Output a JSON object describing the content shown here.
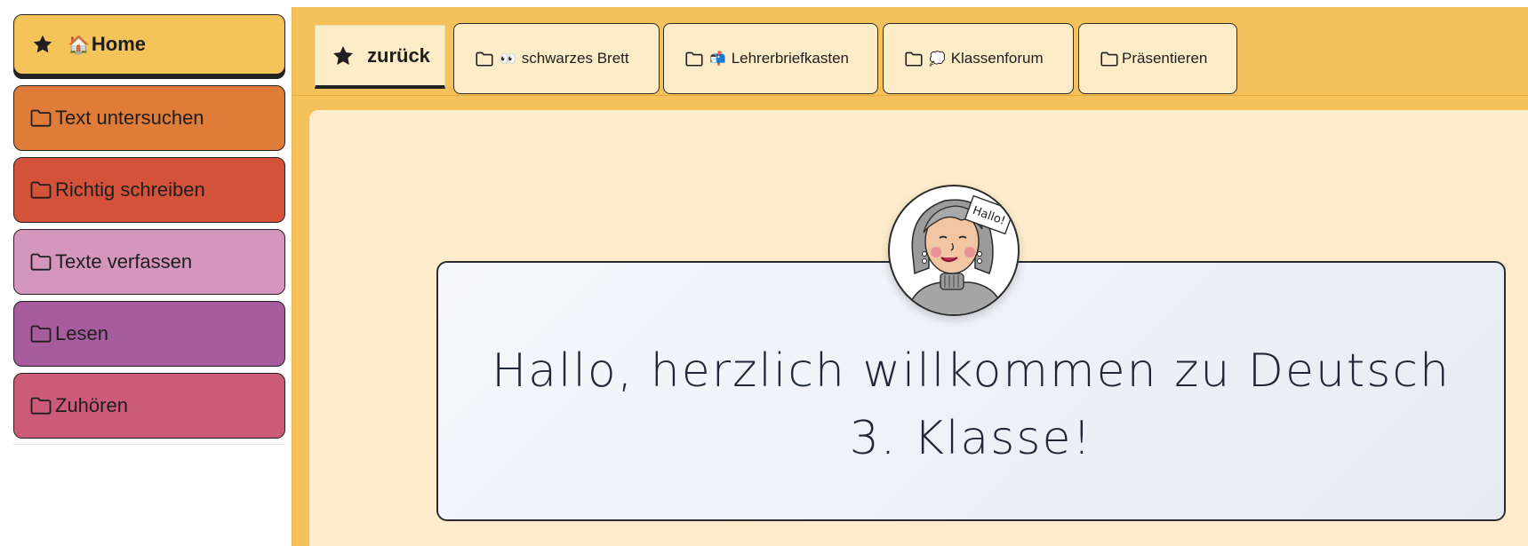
{
  "sidebar": {
    "home": {
      "icon": "star-icon",
      "emoji": "🏠",
      "label": "Home",
      "color": "#f4c45a"
    },
    "items": [
      {
        "label": "Text untersuchen",
        "icon": "folder-icon",
        "color": "#e07c3a"
      },
      {
        "label": "Richtig schreiben",
        "icon": "folder-icon",
        "color": "#d4523a"
      },
      {
        "label": "Texte verfassen",
        "icon": "folder-icon",
        "color": "#d596bd"
      },
      {
        "label": "Lesen",
        "icon": "folder-icon",
        "color": "#a75c9e"
      },
      {
        "label": "Zuhören",
        "icon": "folder-icon",
        "color": "#cc5b77"
      }
    ]
  },
  "tabs": {
    "back": {
      "icon": "star-icon",
      "label": "zurück"
    },
    "items": [
      {
        "emoji": "👀",
        "label": "schwarzes Brett",
        "icon": "folder-icon"
      },
      {
        "emoji": "📬",
        "label": "Lehrerbriefkasten",
        "icon": "folder-icon"
      },
      {
        "emoji": "💭",
        "label": "Klassenforum",
        "icon": "folder-icon"
      },
      {
        "emoji": "",
        "label": "Präsentieren",
        "icon": "folder-icon"
      }
    ]
  },
  "welcome": {
    "line1": "Hallo, herzlich willkommen zu Deutsch",
    "line2": "3. Klasse!",
    "avatar_speech": "Hallo!"
  },
  "colors": {
    "main_bg": "#f4c15b",
    "content_bg": "#fdeccb",
    "tab_bg": "#fdecc8",
    "card_bg": "#eef1f7"
  }
}
